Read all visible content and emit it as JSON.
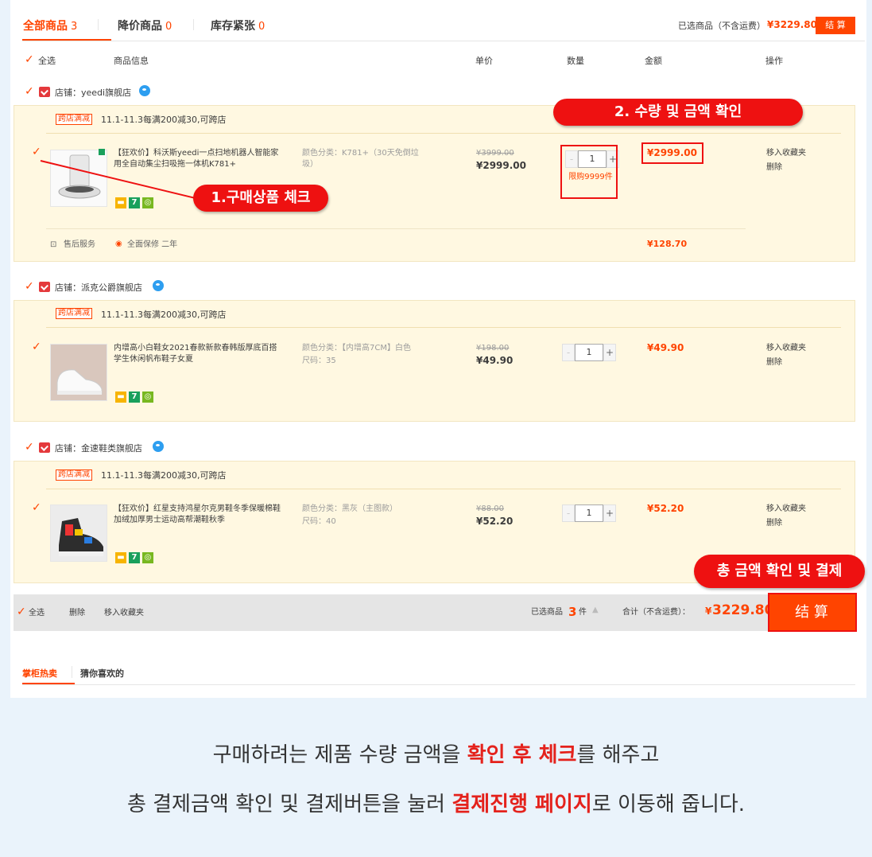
{
  "tabs": [
    {
      "label": "全部商品",
      "count": "3"
    },
    {
      "label": "降价商品",
      "count": "0"
    },
    {
      "label": "库存紧张",
      "count": "0"
    }
  ],
  "summary_top": {
    "label": "已选商品（不含运费）",
    "total": "¥3229.80",
    "button": "结 算"
  },
  "headers": {
    "select_all": "全选",
    "info": "商品信息",
    "price": "单价",
    "qty": "数量",
    "amount": "金额",
    "ops": "操作"
  },
  "shops": [
    {
      "name": "店铺：yeedi旗舰店",
      "promo_tag": "跨店满减",
      "promo_text": "11.1-11.3每满200减30,可跨店",
      "item": {
        "title": "【狂欢价】科沃斯yeedi一点扫地机器人智能家用全自动集尘扫吸拖一体机K781+",
        "spec": "颜色分类：K781+（30天免倒垃圾）",
        "spec2": "",
        "old_price": "¥3999.00",
        "price": "¥2999.00",
        "qty": "1",
        "limit": "限购9999件",
        "amount": "¥2999.00",
        "op1": "移入收藏夹",
        "op2": "删除"
      },
      "service_label": "售后服务",
      "service_item": "全面保修 二年",
      "service_price": "¥128.70"
    },
    {
      "name": "店铺：派克公爵旗舰店",
      "promo_tag": "跨店满减",
      "promo_text": "11.1-11.3每满200减30,可跨店",
      "item": {
        "title": "内增高小白鞋女2021春款新款春韩版厚底百搭学生休闲帆布鞋子女夏",
        "spec": "颜色分类：【内增高7CM】白色",
        "spec2": "尺码：35",
        "old_price": "¥198.00",
        "price": "¥49.90",
        "qty": "1",
        "amount": "¥49.90",
        "op1": "移入收藏夹",
        "op2": "删除"
      }
    },
    {
      "name": "店铺：金速鞋类旗舰店",
      "promo_tag": "跨店满减",
      "promo_text": "11.1-11.3每满200减30,可跨店",
      "item": {
        "title": "【狂欢价】红星支持鸿星尔克男鞋冬季保暖棉鞋加绒加厚男士运动高帮潮鞋秋季",
        "spec": "颜色分类：黑灰（主图款）",
        "spec2": "尺码：40",
        "old_price": "¥88.00",
        "price": "¥52.20",
        "qty": "1",
        "amount": "¥52.20",
        "op1": "移入收藏夹",
        "op2": "删除"
      }
    }
  ],
  "callouts": {
    "check": "1.구매상품 체크",
    "qty": "2. 수량 및 금액 확인",
    "total": "총 금액 확인 및 결제"
  },
  "footer": {
    "select_all": "全选",
    "delete": "删除",
    "favorite": "移入收藏夹",
    "selected_label": "已选商品",
    "selected_count": "3",
    "selected_unit": "件",
    "total_label": "合计（不含运费）：",
    "total_currency": "¥",
    "total_value": "3229.80",
    "checkout": "结 算"
  },
  "bottom_tabs": {
    "hot": "掌柜热卖",
    "guess": "猜你喜欢的"
  },
  "caption": {
    "line1_pre": "구매하려는 제품 수량 금액을 ",
    "line1_em": "확인 후 체크",
    "line1_post": "를 해주고",
    "line2_pre": "총 결제금액 확인 및 결제버튼을 눌러 ",
    "line2_em": "결제진행 페이지",
    "line2_post": "로 이동해 줍니다."
  },
  "colors": {
    "accent": "#ff4400",
    "callout": "#ee1111",
    "shop_bg": "#fff8e1",
    "page_bg": "#eaf3fb"
  }
}
